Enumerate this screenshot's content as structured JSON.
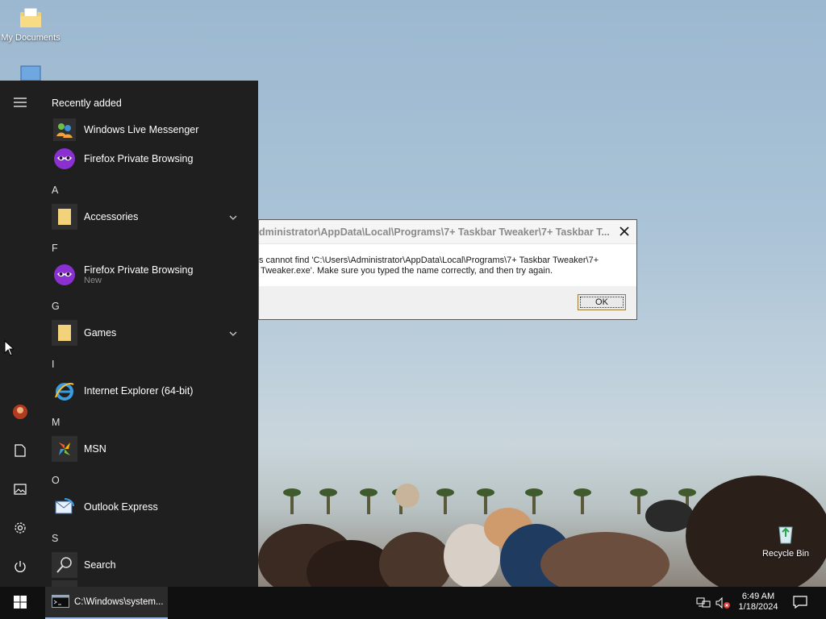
{
  "desktop": {
    "icons": [
      {
        "label": "My Documents"
      },
      {
        "label": "Recycle Bin"
      }
    ]
  },
  "start_menu": {
    "recently_added_label": "Recently added",
    "recent": [
      {
        "label": "Windows Live Messenger",
        "icon": "messenger-icon"
      },
      {
        "label": "Firefox Private Browsing",
        "icon": "firefox-private-icon"
      }
    ],
    "groups": [
      {
        "letter": "A",
        "items": [
          {
            "label": "Accessories",
            "icon": "folder-icon",
            "expandable": true
          }
        ]
      },
      {
        "letter": "F",
        "items": [
          {
            "label": "Firefox Private Browsing",
            "sub": "New",
            "icon": "firefox-private-icon"
          }
        ]
      },
      {
        "letter": "G",
        "items": [
          {
            "label": "Games",
            "icon": "folder-icon",
            "expandable": true
          }
        ]
      },
      {
        "letter": "I",
        "items": [
          {
            "label": "Internet Explorer (64-bit)",
            "icon": "ie-icon"
          }
        ]
      },
      {
        "letter": "M",
        "items": [
          {
            "label": "MSN",
            "icon": "msn-icon"
          }
        ]
      },
      {
        "letter": "O",
        "items": [
          {
            "label": "Outlook Express",
            "icon": "outlook-express-icon"
          }
        ]
      },
      {
        "letter": "S",
        "items": [
          {
            "label": "Search",
            "icon": "search-icon"
          }
        ]
      }
    ],
    "rail": [
      "hamburger-icon",
      "user-avatar",
      "documents-icon",
      "pictures-icon",
      "settings-icon",
      "power-icon"
    ]
  },
  "dialog": {
    "title": "dministrator\\AppData\\Local\\Programs\\7+ Taskbar Tweaker\\7+ Taskbar T...",
    "message_line1": "s cannot find 'C:\\Users\\Administrator\\AppData\\Local\\Programs\\7+ Taskbar Tweaker\\7+",
    "message_line2": "Tweaker.exe'. Make sure you typed the name correctly, and then try again.",
    "ok_label": "OK"
  },
  "taskbar": {
    "running_item": "C:\\Windows\\system...",
    "time": "6:49 AM",
    "date": "1/18/2024"
  },
  "colors": {
    "start_bg": "#1f1f1f",
    "taskbar_bg": "#101010",
    "accent_underline": "#9ab8e0"
  }
}
